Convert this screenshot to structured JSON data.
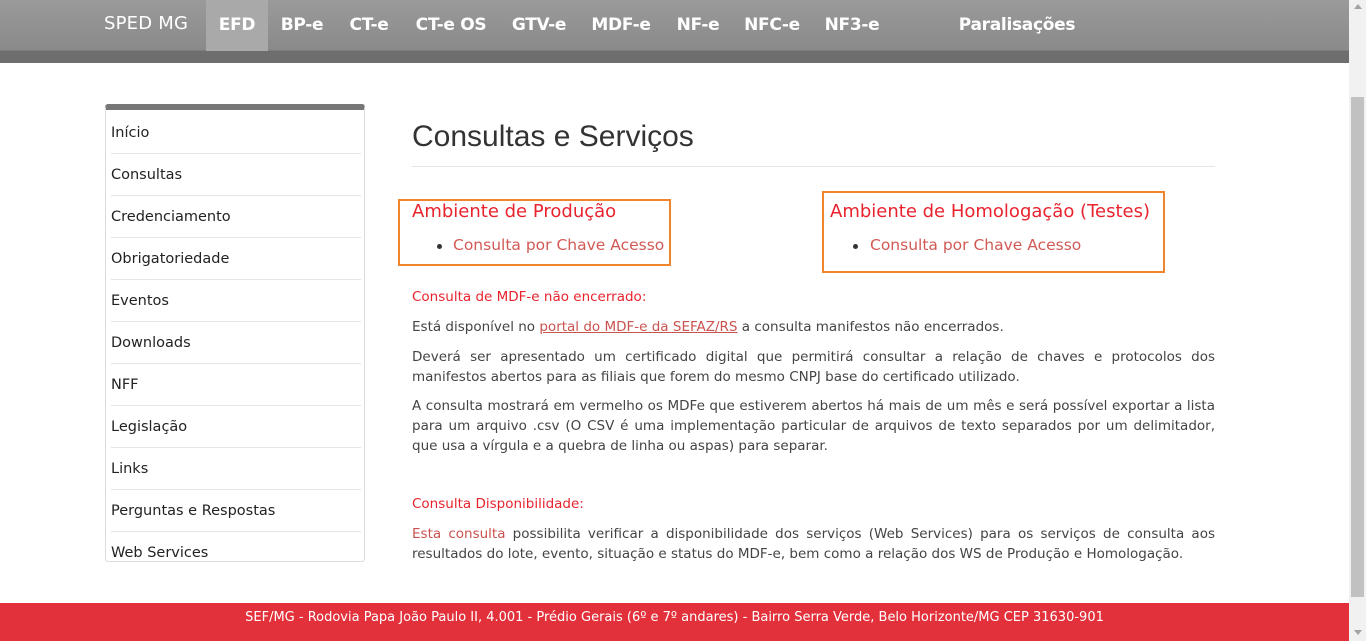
{
  "nav": {
    "brand": "SPED MG",
    "items": [
      "EFD",
      "BP-e",
      "CT-e",
      "CT-e OS",
      "GTV-e",
      "MDF-e",
      "NF-e",
      "NFC-e",
      "NF3-e",
      "Paralisações Programadas"
    ],
    "active": "EFD"
  },
  "sidebar": {
    "items": [
      "Início",
      "Consultas",
      "Credenciamento",
      "Obrigatoriedade",
      "Eventos",
      "Downloads",
      "NFF",
      "Legislação",
      "Links",
      "Perguntas e Respostas",
      "Web Services"
    ]
  },
  "main": {
    "title": "Consultas e Serviços",
    "production": {
      "title": "Ambiente de Produção",
      "link": "Consulta por Chave Acesso"
    },
    "homologation": {
      "title": "Ambiente de Homologação (Testes)",
      "link": "Consulta por Chave Acesso"
    },
    "mdfe_open": {
      "heading": "Consulta de MDF-e não encerrado:",
      "p1_before": "Está disponível no ",
      "p1_link": "portal do MDF-e da SEFAZ/RS",
      "p1_after": " a consulta manifestos não encerrados.",
      "p2": "Deverá ser apresentado um certificado digital que permitirá consultar a relação de chaves e protocolos dos manifestos abertos para as filiais que forem do mesmo CNPJ base do certificado utilizado.",
      "p3": "A consulta mostrará em vermelho os MDFe que estiverem abertos há mais de um mês e será possível exportar a lista para um arquivo .csv (O CSV é uma implementação particular de arquivos de texto separados por um delimitador, que usa a vírgula e a quebra de linha ou aspas) para separar."
    },
    "availability": {
      "heading": "Consulta Disponibilidade:",
      "link": "Esta consulta",
      "text": " possibilita verificar a disponibilidade dos serviços (Web Services) para os serviços de consulta aos resultados do lote, evento, situação e status do MDF-e, bem como a relação dos WS de Produção e Homologação."
    }
  },
  "footer": {
    "text": "SEF/MG - Rodovia Papa João Paulo II, 4.001 - Prédio Gerais (6º e 7º andares) - Bairro Serra Verde, Belo Horizonte/MG CEP 31630-901"
  },
  "colors": {
    "accent_red": "#e8232e",
    "link": "#c9534f",
    "highlight_box": "#f0852d",
    "footer": "#e2313b"
  }
}
